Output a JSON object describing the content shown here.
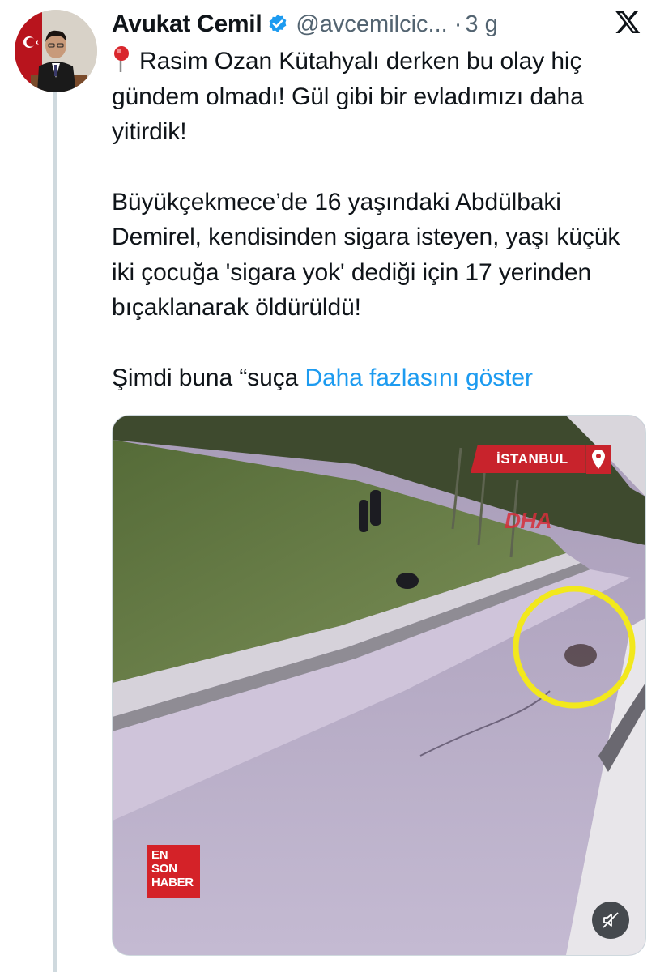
{
  "tweet": {
    "author_name": "Avukat Cemil",
    "handle": "@avcemilcic...",
    "separator": "·",
    "age": "3 g",
    "text_line1": "Rasim Ozan Kütahyalı derken bu olay hiç gündem olmadı! Gül gibi bir evladımızı daha yitirdik!",
    "text_line2": "Büyükçekmece’de 16 yaşındaki Abdülbaki Demirel, kendisinden sigara isteyen, yaşı küçük iki çocuğa 'sigara yok' dediği için 17 yerinden bıçaklanarak öldürüldü!",
    "text_truncated": "Şimdi buna “suça",
    "show_more_label": "Daha fazlasını göster"
  },
  "media": {
    "location_label": "İSTANBUL",
    "watermark": "DHA",
    "corner_logo": [
      "EN",
      "SON",
      "HABER"
    ]
  },
  "icons": {
    "verified": "verified-badge-icon",
    "pin": "round-pushpin-icon",
    "x": "x-logo-icon",
    "mute": "speaker-muted-icon"
  },
  "colors": {
    "link": "#1d9bf0",
    "verified": "#1d9bf0",
    "secondary_text": "#536471",
    "badge_red": "#c8232c",
    "highlight_circle": "#f2e81c"
  }
}
